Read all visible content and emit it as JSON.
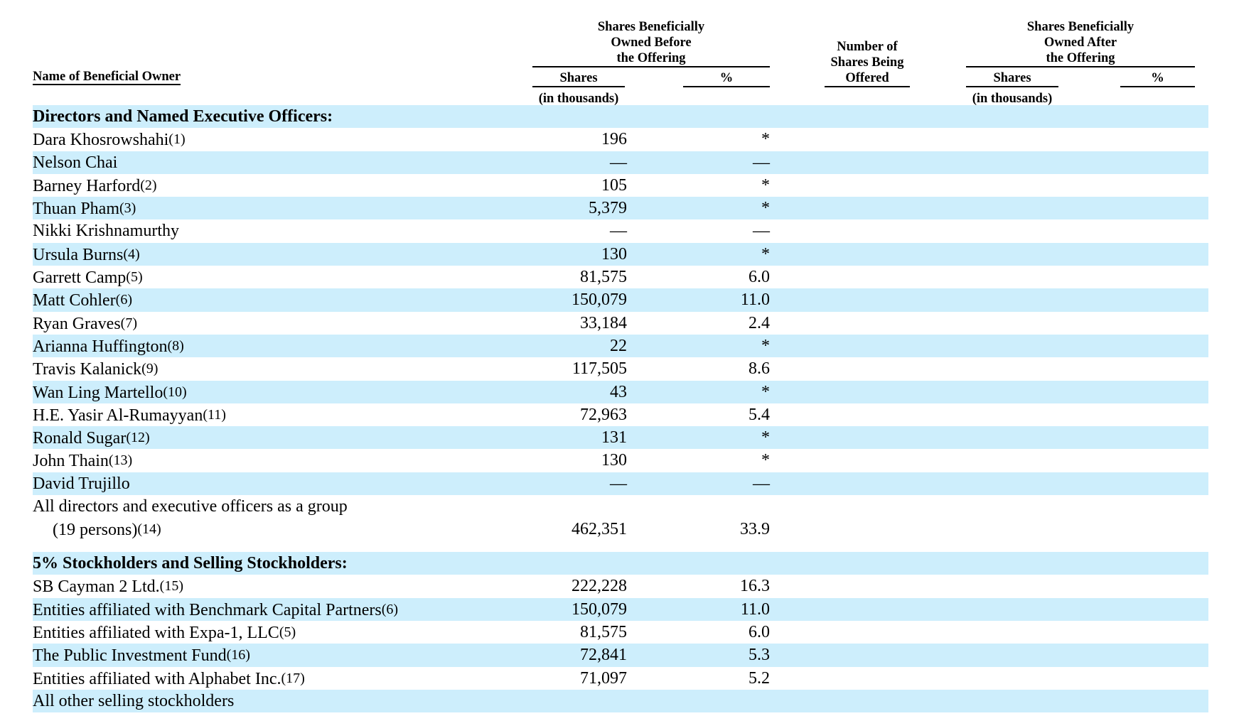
{
  "header": {
    "name_col": "Name of Beneficial Owner",
    "before_group": [
      "Shares Beneficially",
      "Owned Before",
      "the Offering"
    ],
    "after_group": [
      "Shares Beneficially",
      "Owned After",
      "the Offering"
    ],
    "offered_col": [
      "Number of",
      "Shares Being",
      "Offered"
    ],
    "shares_label": "Shares",
    "pct_label": "%",
    "thousands_label": "(in thousands)"
  },
  "rows": [
    {
      "type": "section",
      "name": "Directors and Named Executive Officers:",
      "fn": "",
      "shares": "",
      "pct": ""
    },
    {
      "type": "data",
      "name": "Dara Khosrowshahi",
      "fn": "(1)",
      "shares": "196",
      "pct": "*"
    },
    {
      "type": "data",
      "name": "Nelson Chai",
      "fn": "",
      "shares": "—",
      "pct": "—"
    },
    {
      "type": "data",
      "name": "Barney Harford",
      "fn": "(2)",
      "shares": "105",
      "pct": "*"
    },
    {
      "type": "data",
      "name": "Thuan Pham",
      "fn": "(3)",
      "shares": "5,379",
      "pct": "*"
    },
    {
      "type": "data",
      "name": "Nikki Krishnamurthy",
      "fn": "",
      "shares": "—",
      "pct": "—"
    },
    {
      "type": "data",
      "name": "Ursula Burns",
      "fn": "(4)",
      "shares": "130",
      "pct": "*"
    },
    {
      "type": "data",
      "name": "Garrett Camp",
      "fn": "(5)",
      "shares": "81,575",
      "pct": "6.0"
    },
    {
      "type": "data",
      "name": "Matt Cohler",
      "fn": "(6)",
      "shares": "150,079",
      "pct": "11.0"
    },
    {
      "type": "data",
      "name": "Ryan Graves",
      "fn": "(7)",
      "shares": "33,184",
      "pct": "2.4"
    },
    {
      "type": "data",
      "name": "Arianna Huffington",
      "fn": "(8)",
      "shares": "22",
      "pct": "*"
    },
    {
      "type": "data",
      "name": "Travis Kalanick",
      "fn": "(9)",
      "shares": "117,505",
      "pct": "8.6"
    },
    {
      "type": "data",
      "name": "Wan Ling Martello",
      "fn": "(10)",
      "shares": "43",
      "pct": "*"
    },
    {
      "type": "data",
      "name": "H.E. Yasir Al-Rumayyan",
      "fn": "(11)",
      "shares": "72,963",
      "pct": "5.4"
    },
    {
      "type": "data",
      "name": "Ronald Sugar",
      "fn": "(12)",
      "shares": "131",
      "pct": "*"
    },
    {
      "type": "data",
      "name": "John Thain",
      "fn": "(13)",
      "shares": "130",
      "pct": "*"
    },
    {
      "type": "data",
      "name": "David Trujillo",
      "fn": "",
      "shares": "—",
      "pct": "—"
    },
    {
      "type": "group",
      "name": "All directors and executive officers as a group",
      "name2": "(19 persons)",
      "fn": "(14)",
      "shares": "462,351",
      "pct": "33.9"
    },
    {
      "type": "section",
      "name": "5% Stockholders and Selling Stockholders:",
      "fn": "",
      "shares": "",
      "pct": ""
    },
    {
      "type": "data",
      "name": "SB Cayman 2 Ltd.",
      "fn": "(15)",
      "shares": "222,228",
      "pct": "16.3"
    },
    {
      "type": "data",
      "name": "Entities affiliated with Benchmark Capital Partners",
      "fn": "(6)",
      "shares": "150,079",
      "pct": "11.0"
    },
    {
      "type": "data",
      "name": "Entities affiliated with Expa-1, LLC",
      "fn": "(5)",
      "shares": "81,575",
      "pct": "6.0"
    },
    {
      "type": "data",
      "name": "The Public Investment Fund",
      "fn": "(16)",
      "shares": "72,841",
      "pct": "5.3"
    },
    {
      "type": "data",
      "name": "Entities affiliated with Alphabet Inc.",
      "fn": "(17)",
      "shares": "71,097",
      "pct": "5.2"
    },
    {
      "type": "data",
      "name": "All other selling stockholders",
      "fn": "",
      "shares": "",
      "pct": ""
    }
  ],
  "colors": {
    "row_shade": "#cdeefc"
  }
}
